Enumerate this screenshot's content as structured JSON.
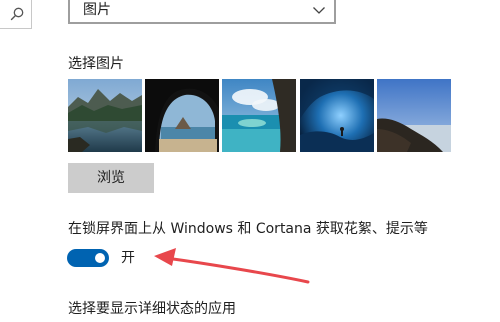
{
  "background": {
    "dropdown_value": "图片"
  },
  "choose_picture": {
    "label": "选择图片",
    "thumbnails": [
      {
        "icon": "mountain-lake-thumbnail"
      },
      {
        "icon": "sea-cave-arch-thumbnail"
      },
      {
        "icon": "tropical-beach-thumbnail"
      },
      {
        "icon": "ice-cave-thumbnail"
      },
      {
        "icon": "coastal-hill-thumbnail"
      }
    ],
    "browse_label": "浏览"
  },
  "lock_screen_tips": {
    "label": "在锁屏界面上从 Windows 和 Cortana 获取花絮、提示等",
    "state_label": "开",
    "on": true
  },
  "detail_status": {
    "label": "选择要显示详细状态的应用"
  },
  "colors": {
    "accent": "#0063b1",
    "annotation": "#e8474c",
    "button_bg": "#cccccc"
  }
}
